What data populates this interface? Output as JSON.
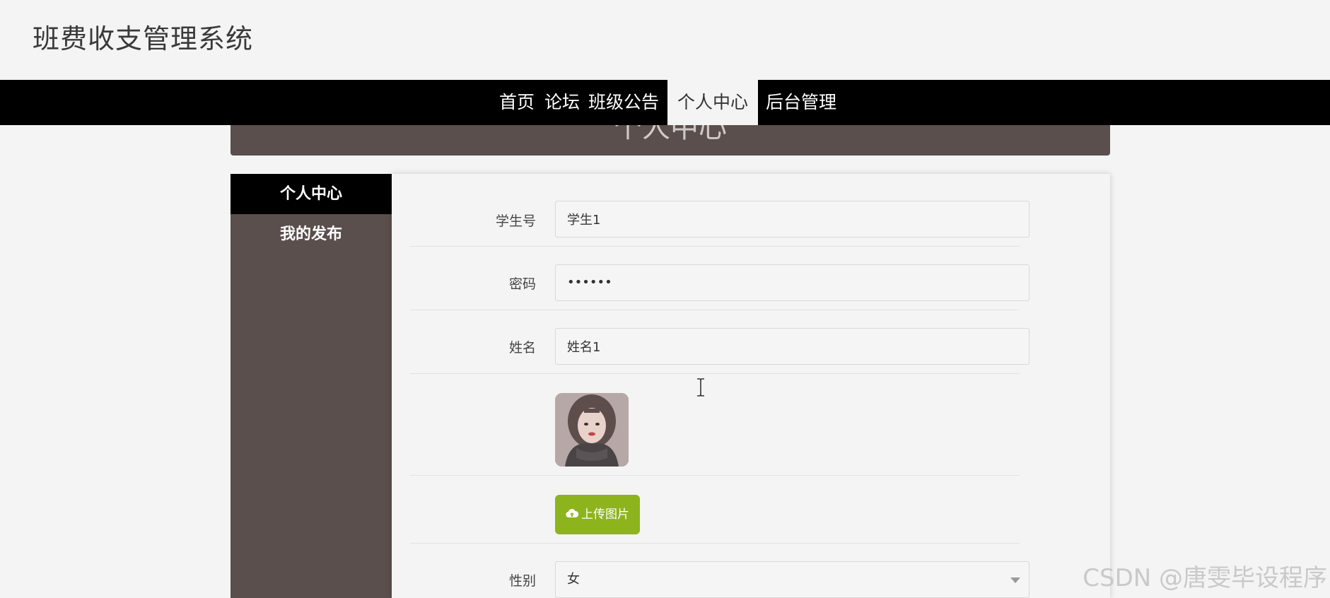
{
  "site": {
    "title": "班费收支管理系统"
  },
  "nav": {
    "items": [
      {
        "label": "首页"
      },
      {
        "label": "论坛"
      },
      {
        "label": "班级公告"
      },
      {
        "label": "个人中心"
      },
      {
        "label": "后台管理"
      }
    ],
    "active": "个人中心"
  },
  "banner": {
    "title": "个人中心"
  },
  "sidebar": {
    "items": [
      {
        "label": "个人中心"
      },
      {
        "label": "我的发布"
      }
    ],
    "active": "个人中心"
  },
  "form": {
    "student_no": {
      "label": "学生号",
      "value": "学生1"
    },
    "password": {
      "label": "密码",
      "value": "••••••"
    },
    "name": {
      "label": "姓名",
      "value": "姓名1"
    },
    "upload": {
      "label": "上传图片",
      "icon": "cloud-upload-icon"
    },
    "gender": {
      "label": "性别",
      "value": "女"
    }
  },
  "watermark": "CSDN @唐雯毕设程序",
  "colors": {
    "nav_bg": "#000000",
    "sidebar_bg": "#5a4f4d",
    "upload_button": "#8db41c",
    "page_bg": "#f4f4f4"
  }
}
